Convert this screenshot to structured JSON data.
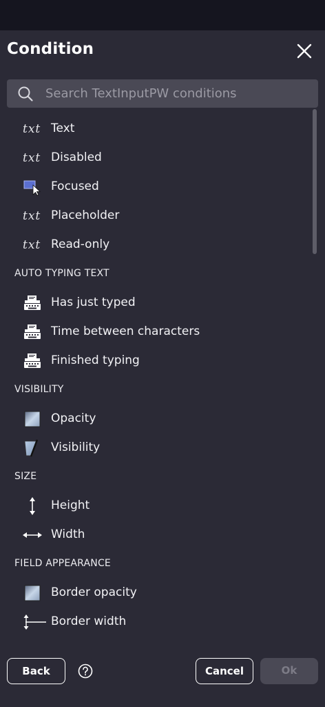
{
  "dialog": {
    "title": "Condition",
    "search": {
      "placeholder": "Search TextInputPW conditions",
      "value": ""
    }
  },
  "groups": [
    {
      "heading": "",
      "items": [
        {
          "label": "Text",
          "icon": "txt-icon"
        },
        {
          "label": "Disabled",
          "icon": "txt-icon"
        },
        {
          "label": "Focused",
          "icon": "focus-cursor-icon"
        },
        {
          "label": "Placeholder",
          "icon": "txt-icon"
        },
        {
          "label": "Read-only",
          "icon": "txt-icon"
        }
      ]
    },
    {
      "heading": "AUTO TYPING TEXT",
      "items": [
        {
          "label": "Has just typed",
          "icon": "typewriter-icon"
        },
        {
          "label": "Time between characters",
          "icon": "typewriter-icon"
        },
        {
          "label": "Finished typing",
          "icon": "typewriter-icon"
        }
      ]
    },
    {
      "heading": "VISIBILITY",
      "items": [
        {
          "label": "Opacity",
          "icon": "opacity-square-icon"
        },
        {
          "label": "Visibility",
          "icon": "visibility-icon"
        }
      ]
    },
    {
      "heading": "SIZE",
      "items": [
        {
          "label": "Height",
          "icon": "vertical-arrow-icon"
        },
        {
          "label": "Width",
          "icon": "horizontal-arrow-icon"
        }
      ]
    },
    {
      "heading": "FIELD APPEARANCE",
      "items": [
        {
          "label": "Border opacity",
          "icon": "opacity-square-icon"
        },
        {
          "label": "Border width",
          "icon": "border-width-icon"
        }
      ]
    }
  ],
  "footer": {
    "back_label": "Back",
    "cancel_label": "Cancel",
    "ok_label": "Ok",
    "help_icon": "question-circle-icon"
  },
  "colors": {
    "panel_bg": "#2b2a36",
    "search_bg": "#4a4955",
    "disabled_text": "#7d7c87"
  }
}
